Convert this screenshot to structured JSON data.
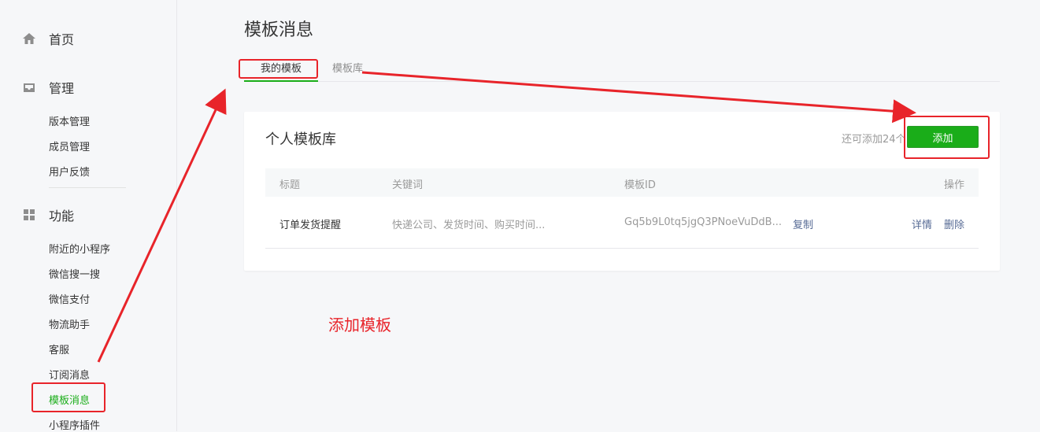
{
  "sidebar": {
    "home_label": "首页",
    "manage_label": "管理",
    "manage_items": [
      "版本管理",
      "成员管理",
      "用户反馈"
    ],
    "function_label": "功能",
    "function_items": [
      "附近的小程序",
      "微信搜一搜",
      "微信支付",
      "物流助手",
      "客服",
      "订阅消息",
      "模板消息",
      "小程序插件"
    ],
    "active_item": "模板消息"
  },
  "main": {
    "page_title": "模板消息",
    "tabs": [
      {
        "label": "我的模板",
        "active": true
      },
      {
        "label": "模板库",
        "active": false
      }
    ],
    "card": {
      "title": "个人模板库",
      "quota_text": "还可添加24个",
      "add_button": "添加",
      "columns": [
        "标题",
        "关键词",
        "模板ID",
        "操作"
      ],
      "rows": [
        {
          "title": "订单发货提醒",
          "keywords": "快递公司、发货时间、购买时间...",
          "template_id": "Gq5b9L0tq5jgQ3PNoeVuDdB...",
          "copy_label": "复制",
          "detail_label": "详情",
          "delete_label": "删除"
        }
      ]
    }
  },
  "annotation": {
    "text": "添加模板",
    "color": "#e8242a"
  },
  "colors": {
    "accent": "#1aad19",
    "link": "#576b95",
    "annotation": "#e8242a"
  },
  "icons": [
    "home-icon",
    "inbox-icon",
    "grid-icon"
  ]
}
